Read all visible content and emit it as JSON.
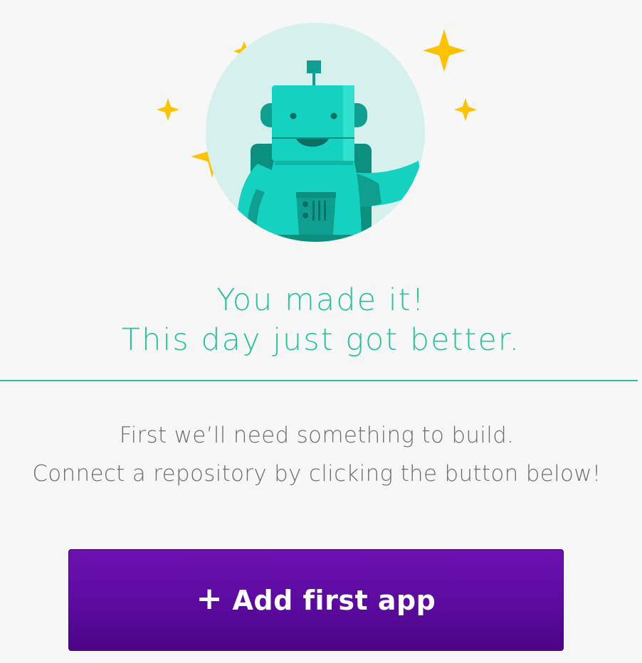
{
  "hero": {
    "illustration": "robot-mascot-illustration",
    "sparkle_icon": "sparkle-icon"
  },
  "headline": {
    "line1": "You made it!",
    "line2": "This day just got better."
  },
  "message": {
    "line1": "First we’ll need something to build.",
    "line2": "Connect a repository by clicking the button below!"
  },
  "add_button": {
    "icon": "plus-icon",
    "icon_glyph": "+",
    "label": "Add first app"
  },
  "colors": {
    "background": "#f7f7f7",
    "accent_green": "#25c49c",
    "button_purple": "#5b0a9f",
    "sparkle_yellow": "#ffc200",
    "robot_teal": "#14d1c0",
    "circle_mint": "#d5f0ed"
  }
}
